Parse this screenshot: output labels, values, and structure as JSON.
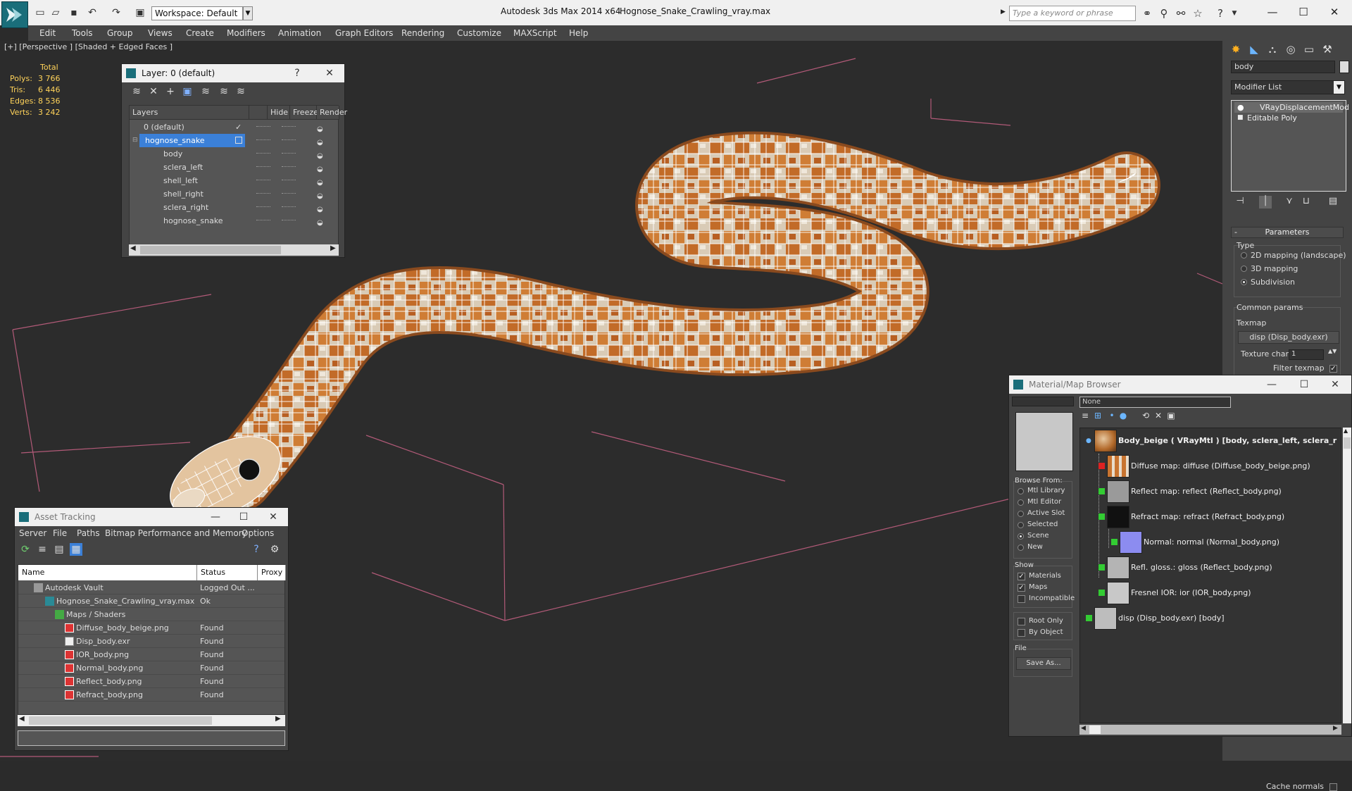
{
  "titlebar": {
    "workspace": "Workspace: Default",
    "app_title": "Autodesk 3ds Max  2014 x64",
    "file_title": "Hognose_Snake_Crawling_vray.max",
    "search_placeholder": "Type a keyword or phrase"
  },
  "menu": [
    "Edit",
    "Tools",
    "Group",
    "Views",
    "Create",
    "Modifiers",
    "Animation",
    "Graph Editors",
    "Rendering",
    "Customize",
    "MAXScript",
    "Help"
  ],
  "viewport": {
    "label": "[+] [Perspective ] [Shaded + Edged Faces ]",
    "stats": {
      "total_label": "Total",
      "rows": [
        {
          "label": "Polys:",
          "value": "3 766"
        },
        {
          "label": "Tris:",
          "value": "6 446"
        },
        {
          "label": "Edges:",
          "value": "8 536"
        },
        {
          "label": "Verts:",
          "value": "3 242"
        }
      ]
    }
  },
  "layer_dialog": {
    "title": "Layer: 0 (default)",
    "help": "?",
    "close": "✕",
    "columns": [
      "Layers",
      "Hide",
      "Freeze",
      "Render"
    ],
    "rows": [
      {
        "name": "0 (default)",
        "level": 0,
        "selected": false,
        "active": true
      },
      {
        "name": "hognose_snake",
        "level": 0,
        "selected": true,
        "active": false
      },
      {
        "name": "body",
        "level": 1,
        "selected": false,
        "active": false
      },
      {
        "name": "sclera_left",
        "level": 1,
        "selected": false,
        "active": false
      },
      {
        "name": "shell_left",
        "level": 1,
        "selected": false,
        "active": false
      },
      {
        "name": "shell_right",
        "level": 1,
        "selected": false,
        "active": false
      },
      {
        "name": "sclera_right",
        "level": 1,
        "selected": false,
        "active": false
      },
      {
        "name": "hognose_snake",
        "level": 1,
        "selected": false,
        "active": false
      }
    ]
  },
  "asset_dialog": {
    "title": "Asset Tracking",
    "menu": [
      "Server",
      "File",
      "Paths",
      "Bitmap Performance and Memory",
      "Options"
    ],
    "columns": [
      "Name",
      "Status",
      "Proxy"
    ],
    "rows": [
      {
        "name": "Autodesk Vault",
        "status": "Logged Out ...",
        "level": 0,
        "icon": "vault-icon"
      },
      {
        "name": "Hognose_Snake_Crawling_vray.max",
        "status": "Ok",
        "level": 1,
        "icon": "max-file-icon"
      },
      {
        "name": "Maps / Shaders",
        "status": "",
        "level": 2,
        "icon": "maps-folder-icon"
      },
      {
        "name": "Diffuse_body_beige.png",
        "status": "Found",
        "level": 3,
        "icon": "png-icon"
      },
      {
        "name": "Disp_body.exr",
        "status": "Found",
        "level": 3,
        "icon": "exr-icon"
      },
      {
        "name": "IOR_body.png",
        "status": "Found",
        "level": 3,
        "icon": "png-icon"
      },
      {
        "name": "Normal_body.png",
        "status": "Found",
        "level": 3,
        "icon": "png-icon"
      },
      {
        "name": "Reflect_body.png",
        "status": "Found",
        "level": 3,
        "icon": "png-icon"
      },
      {
        "name": "Refract_body.png",
        "status": "Found",
        "level": 3,
        "icon": "png-icon"
      }
    ]
  },
  "command_panel": {
    "object_name": "body",
    "modifier_list": "Modifier List",
    "stack": [
      "VRayDisplacementMod",
      "Editable Poly"
    ],
    "parameters": {
      "header": "Parameters",
      "type_label": "Type",
      "type_options": [
        {
          "label": "2D mapping (landscape)",
          "on": false
        },
        {
          "label": "3D mapping",
          "on": false
        },
        {
          "label": "Subdivision",
          "on": true
        }
      ],
      "common_label": "Common params",
      "texmap_label": "Texmap",
      "texmap_button": "disp (Disp_body.exr)",
      "texture_chan_label": "Texture chan",
      "texture_chan_value": "1",
      "filter_texmap_label": "Filter texmap",
      "cache_normals_label": "Cache normals"
    }
  },
  "material_browser": {
    "title": "Material/Map Browser",
    "search_value": "None",
    "browse_from_label": "Browse From:",
    "browse_from": [
      {
        "label": "Mtl Library",
        "on": false
      },
      {
        "label": "Mtl Editor",
        "on": false
      },
      {
        "label": "Active Slot",
        "on": false
      },
      {
        "label": "Selected",
        "on": false
      },
      {
        "label": "Scene",
        "on": true
      },
      {
        "label": "New",
        "on": false
      }
    ],
    "show_label": "Show",
    "show": [
      {
        "label": "Materials",
        "on": true
      },
      {
        "label": "Maps",
        "on": true
      },
      {
        "label": "Incompatible",
        "on": false
      }
    ],
    "root_only": "Root Only",
    "by_object": "By Object",
    "file_label": "File",
    "save_as": "Save As...",
    "tree": [
      {
        "label": "Body_beige  ( VRayMtl ) [body, sclera_left, sclera_r",
        "bold": true,
        "indent": 0,
        "thumb": "material-sphere",
        "link": "none"
      },
      {
        "label": "Diffuse map: diffuse (Diffuse_body_beige.png)",
        "bold": false,
        "indent": 1,
        "thumb": "diffuse-thumb",
        "link": "red"
      },
      {
        "label": "Reflect map: reflect (Reflect_body.png)",
        "bold": false,
        "indent": 1,
        "thumb": "reflect-thumb",
        "link": "green"
      },
      {
        "label": "Refract map: refract (Refract_body.png)",
        "bold": false,
        "indent": 1,
        "thumb": "refract-thumb",
        "link": "green"
      },
      {
        "label": "Normal: normal (Normal_body.png)",
        "bold": false,
        "indent": 2,
        "thumb": "normal-thumb",
        "link": "green"
      },
      {
        "label": "Refl. gloss.: gloss (Reflect_body.png)",
        "bold": false,
        "indent": 1,
        "thumb": "gloss-thumb",
        "link": "green"
      },
      {
        "label": "Fresnel IOR: ior (IOR_body.png)",
        "bold": false,
        "indent": 1,
        "thumb": "ior-thumb",
        "link": "green"
      },
      {
        "label": "disp (Disp_body.exr)  [body]",
        "bold": false,
        "indent": 0,
        "thumb": "disp-thumb",
        "link": "green"
      }
    ]
  },
  "colors": {
    "stats_text": "#ffd35a",
    "selection": "#3b80d8",
    "snake_orange": "#c8742c",
    "snake_cream": "#e7dccc"
  }
}
